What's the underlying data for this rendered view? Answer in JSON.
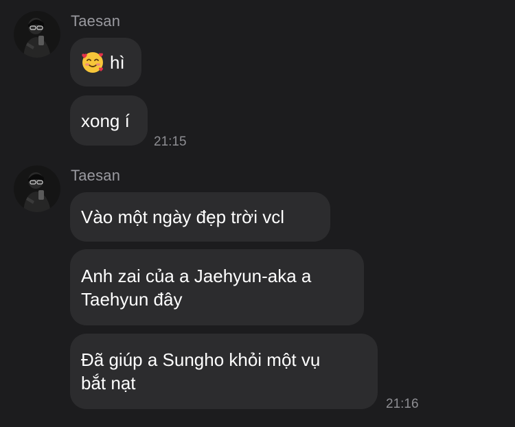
{
  "groups": [
    {
      "sender": "Taesan",
      "messages": [
        {
          "emoji": "smiling-face-with-hearts",
          "text": "hì"
        },
        {
          "text": "xong í",
          "time": "21:15"
        }
      ]
    },
    {
      "sender": "Taesan",
      "messages": [
        {
          "text": "Vào một ngày đẹp trời vcl"
        },
        {
          "text": "Anh zai của a Jaehyun-aka a\nTaehyun đây"
        },
        {
          "text": "Đã giúp a Sungho khỏi một vụ\nbắt nạt",
          "time": "21:16"
        }
      ]
    }
  ],
  "colors": {
    "background": "#1c1c1e",
    "bubble": "#2c2c2e",
    "sender": "#9a9aa0",
    "timestamp": "#8e8e93",
    "text": "#ffffff"
  }
}
